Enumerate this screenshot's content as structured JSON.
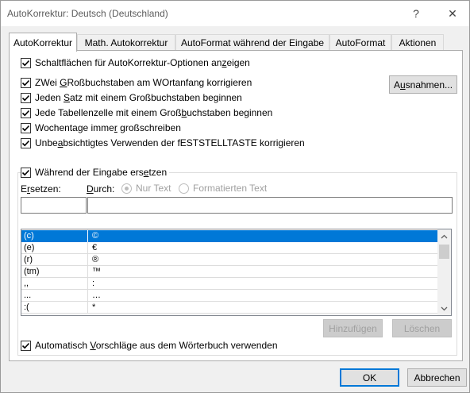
{
  "window": {
    "title": "AutoKorrektur: Deutsch (Deutschland)",
    "help_glyph": "?",
    "close_glyph": "✕"
  },
  "tabs": [
    {
      "label": "AutoKorrektur",
      "active": true
    },
    {
      "label": "Math. Autokorrektur",
      "active": false
    },
    {
      "label": "AutoFormat während der Eingabe",
      "active": false
    },
    {
      "label": "AutoFormat",
      "active": false
    },
    {
      "label": "Aktionen",
      "active": false
    }
  ],
  "options": {
    "show_buttons": {
      "label_pre": "Schaltflächen für AutoKorrektur-Optionen an",
      "label_u": "z",
      "label_post": "eigen",
      "checked": true
    },
    "two_caps": {
      "label_pre": "ZWei ",
      "label_u": "G",
      "label_post": "Roßbuchstaben am WOrtanfang korrigieren",
      "checked": true
    },
    "sentence": {
      "label_pre": "Jeden ",
      "label_u": "S",
      "label_post": "atz mit einem Großbuchstaben beginnen",
      "checked": true
    },
    "table_cell": {
      "label_pre": "Jede Tabellenzelle mit einem Groß",
      "label_u": "b",
      "label_post": "uchstaben beginnen",
      "checked": true
    },
    "weekdays": {
      "label_pre": "Wochentage imme",
      "label_u": "r",
      "label_post": " großschreiben",
      "checked": true
    },
    "caps_lock": {
      "label_pre": "Unbe",
      "label_u": "a",
      "label_post": "bsichtigtes Verwenden der fESTSTELLTASTE korrigieren",
      "checked": true
    },
    "replace_typing": {
      "label_pre": "Während der Eingabe ers",
      "label_u": "e",
      "label_post": "tzen",
      "checked": true
    },
    "dictionary": {
      "label_pre": "Automatisch ",
      "label_u": "V",
      "label_post": "orschläge aus dem Wörterbuch verwenden",
      "checked": true
    }
  },
  "buttons": {
    "exceptions_pre": "A",
    "exceptions_u": "u",
    "exceptions_post": "snahmen...",
    "add": "Hinzufügen",
    "delete": "Löschen",
    "ok": "OK",
    "cancel": "Abbrechen"
  },
  "replace": {
    "replace_label_pre": "E",
    "replace_label_u": "r",
    "replace_label_post": "setzen:",
    "with_label_pre": "",
    "with_label_u": "D",
    "with_label_post": "urch:",
    "plain_text": "Nur Text",
    "formatted_text": "Formatierten Text",
    "plain_selected": true,
    "replace_value": "",
    "with_value": ""
  },
  "entries": [
    {
      "from": "(c)",
      "to": "©",
      "selected": true
    },
    {
      "from": "(e)",
      "to": "€",
      "selected": false
    },
    {
      "from": "(r)",
      "to": "®",
      "selected": false
    },
    {
      "from": "(tm)",
      "to": "™",
      "selected": false
    },
    {
      "from": ",,",
      "to": ":",
      "selected": false
    },
    {
      "from": "...",
      "to": "…",
      "selected": false
    },
    {
      "from": ":(",
      "to": "*",
      "selected": false
    }
  ],
  "colors": {
    "selection": "#0078d7",
    "default_button_border": "#0078d7"
  }
}
